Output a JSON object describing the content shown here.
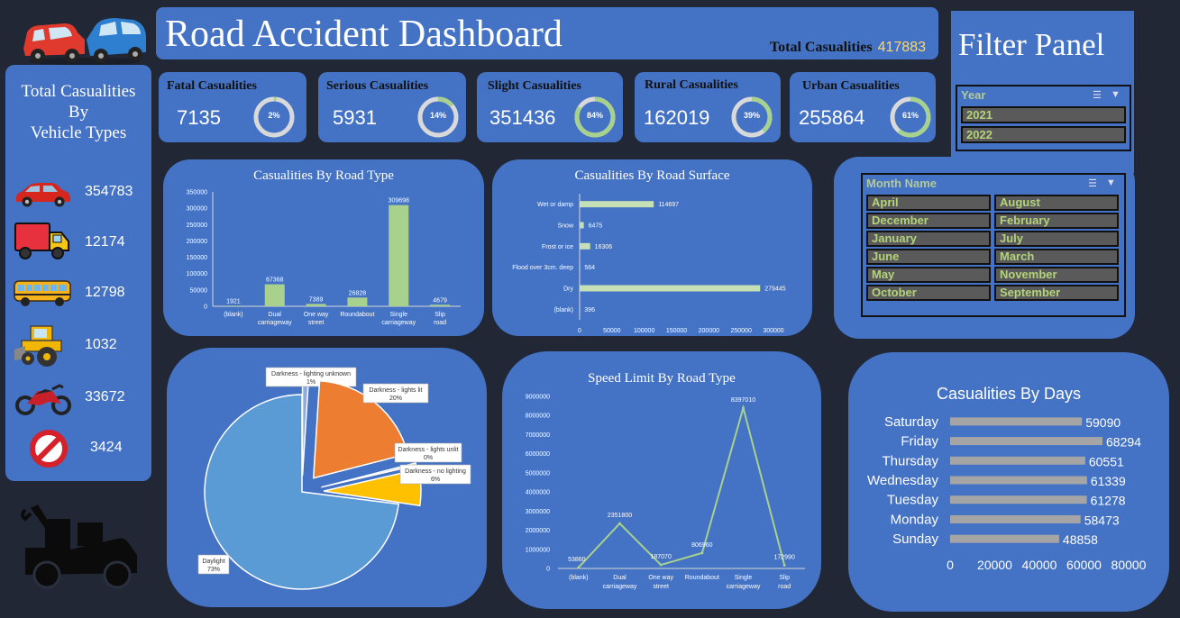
{
  "header": {
    "title": "Road Accident Dashboard",
    "total_label": "Total Casualities",
    "total_value": "417883"
  },
  "kpis": [
    {
      "label": "Fatal Casualities",
      "value": "7135",
      "pct_label": "2%",
      "pct": 0.02
    },
    {
      "label": "Serious Casualities",
      "value": "5931",
      "pct_label": "14%",
      "pct": 0.14
    },
    {
      "label": "Slight Casualities",
      "value": "351436",
      "pct_label": "84%",
      "pct": 0.84
    },
    {
      "label": "Rural Casualities",
      "value": "162019",
      "pct_label": "39%",
      "pct": 0.39
    },
    {
      "label": "Urban Casualities",
      "value": "255864",
      "pct_label": "61%",
      "pct": 0.61
    }
  ],
  "vehicles": {
    "title_line1": "Total Casualities",
    "title_line2": "By",
    "title_line3": "Vehicle Types",
    "items": [
      {
        "icon": "car-icon",
        "value": "354783"
      },
      {
        "icon": "truck-icon",
        "value": "12174"
      },
      {
        "icon": "bus-icon",
        "value": "12798"
      },
      {
        "icon": "tractor-icon",
        "value": "1032"
      },
      {
        "icon": "motorcycle-icon",
        "value": "33672"
      },
      {
        "icon": "prohibited-icon",
        "value": "3424"
      }
    ]
  },
  "filter": {
    "title": "Filter Panel",
    "year": {
      "header": "Year",
      "options": [
        "2021",
        "2022"
      ]
    },
    "month": {
      "header": "Month Name",
      "options": [
        "April",
        "August",
        "December",
        "February",
        "January",
        "July",
        "June",
        "March",
        "May",
        "November",
        "October",
        "September"
      ]
    }
  },
  "colors": {
    "panel": "#4472c4",
    "background": "#212735",
    "green": "#a9d18e",
    "gray_bar": "#a5a5a5",
    "pie_blue": "#5b9bd5",
    "pie_orange": "#ed7d31",
    "pie_yellow": "#ffc000"
  },
  "chart_data": [
    {
      "type": "bar",
      "title": "Casualities By Road Type",
      "categories": [
        "(blank)",
        "Dual carriageway",
        "One way street",
        "Roundabout",
        "Single carriageway",
        "Slip road"
      ],
      "values": [
        1921,
        67368,
        7389,
        26828,
        309698,
        4679
      ],
      "ylim": [
        0,
        350000
      ],
      "yticks": [
        0,
        50000,
        100000,
        150000,
        200000,
        250000,
        300000,
        350000
      ]
    },
    {
      "type": "bar",
      "orientation": "horizontal",
      "title": "Casualities By Road Surface",
      "categories": [
        "Wet or damp",
        "Snow",
        "Frost or ice",
        "Flood over 3cm. deep",
        "Dry",
        "(blank)"
      ],
      "values": [
        114697,
        6475,
        16306,
        564,
        279445,
        396
      ],
      "xlim": [
        0,
        300000
      ],
      "xticks": [
        0,
        50000,
        100000,
        150000,
        200000,
        250000,
        300000
      ]
    },
    {
      "type": "pie",
      "categories": [
        "Daylight",
        "Darkness - lighting unknown",
        "Darkness - lights lit",
        "Darkness - lights unlit",
        "Darkness - no lighting"
      ],
      "values": [
        73,
        1,
        20,
        0,
        6
      ],
      "value_labels": [
        "73%",
        "1%",
        "20%",
        "0%",
        "6%"
      ]
    },
    {
      "type": "line",
      "title": "Speed Limit By Road Type",
      "categories": [
        "(blank)",
        "Dual carriageway",
        "One way street",
        "Roundabout",
        "Single carriageway",
        "Slip road"
      ],
      "values": [
        53860,
        2351800,
        187070,
        806960,
        8397010,
        172990
      ],
      "ylim": [
        0,
        9000000
      ],
      "yticks": [
        0,
        1000000,
        2000000,
        3000000,
        4000000,
        5000000,
        6000000,
        7000000,
        8000000,
        9000000
      ]
    },
    {
      "type": "bar",
      "orientation": "horizontal",
      "title": "Casualities By Days",
      "categories": [
        "Saturday",
        "Friday",
        "Thursday",
        "Wednesday",
        "Tuesday",
        "Monday",
        "Sunday"
      ],
      "values": [
        59090,
        68294,
        60551,
        61339,
        61278,
        58473,
        48858
      ],
      "xlim": [
        0,
        80000
      ],
      "xticks": [
        0,
        20000,
        40000,
        60000,
        80000
      ]
    }
  ]
}
